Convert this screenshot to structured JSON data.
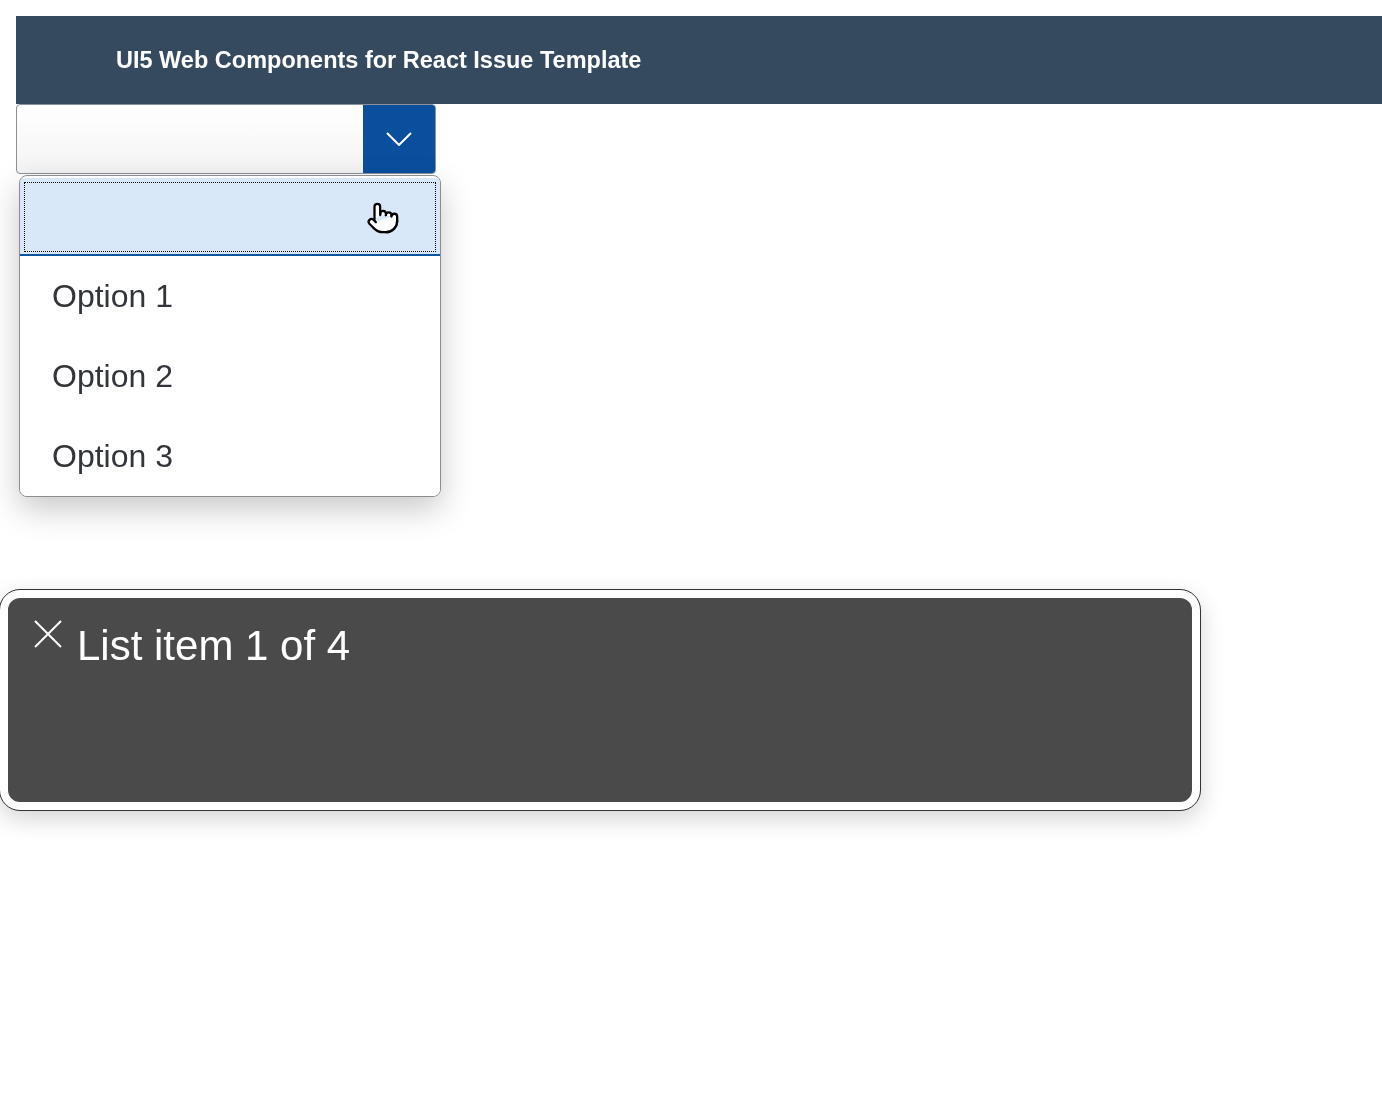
{
  "header": {
    "title": "UI5 Web Components for React Issue Template"
  },
  "select": {
    "expanded": true
  },
  "dropdown": {
    "items": [
      {
        "selected": true
      },
      {
        "label": "Option 1",
        "selected": false
      },
      {
        "label": "Option 2",
        "selected": false
      },
      {
        "label": "Option 3",
        "selected": false
      }
    ]
  },
  "caption_panel": {
    "text": "List item 1 of 4"
  }
}
